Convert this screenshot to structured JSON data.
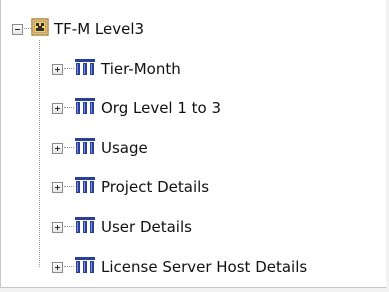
{
  "tree": {
    "root": {
      "label": "TF-M Level3",
      "icon": "report-folder-icon",
      "expanded": true
    },
    "children": [
      {
        "label": "Tier-Month",
        "icon": "dimension-icon",
        "expanded": false
      },
      {
        "label": "Org Level 1 to 3",
        "icon": "dimension-icon",
        "expanded": false
      },
      {
        "label": "Usage",
        "icon": "dimension-icon",
        "expanded": false
      },
      {
        "label": "Project Details",
        "icon": "dimension-icon",
        "expanded": false
      },
      {
        "label": "User Details",
        "icon": "dimension-icon",
        "expanded": false
      },
      {
        "label": "License Server Host Details",
        "icon": "dimension-icon",
        "expanded": false
      }
    ]
  },
  "colors": {
    "dimension_icon": "#2a3f9a",
    "folder_icon_frame": "#9a6a1f",
    "folder_icon_fill": "#f3d26b",
    "expander_border": "#8a8a8a"
  }
}
